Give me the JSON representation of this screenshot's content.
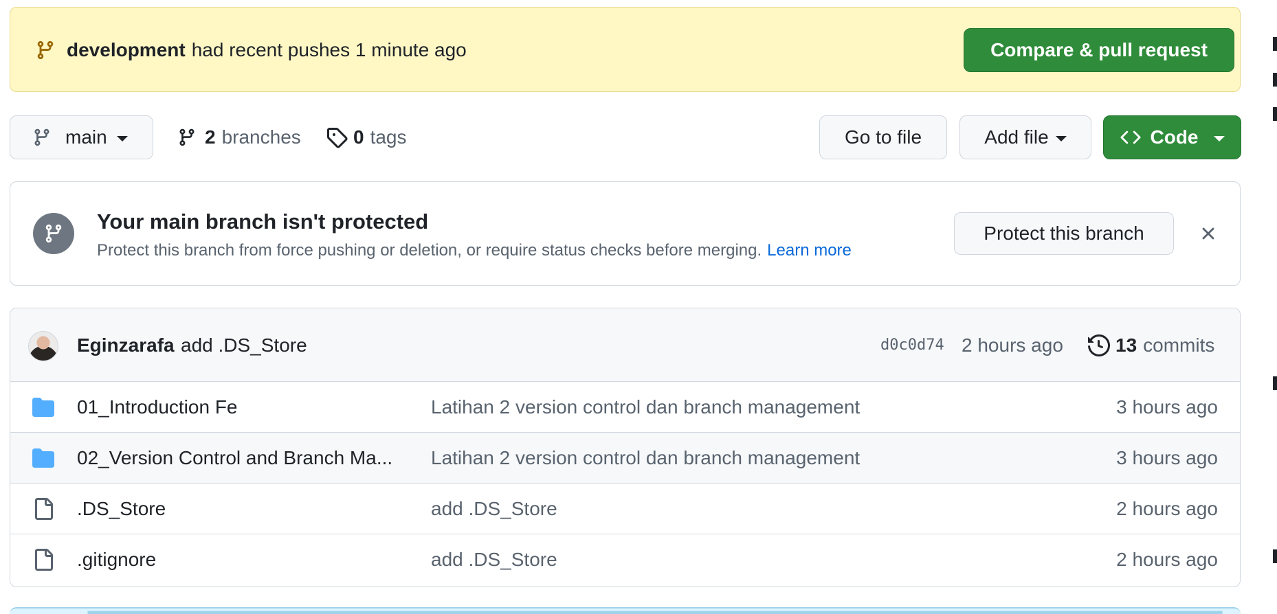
{
  "push_banner": {
    "branch": "development",
    "message": "had recent pushes 1 minute ago",
    "button": "Compare & pull request"
  },
  "toolbar": {
    "current_branch": "main",
    "branches_count": "2",
    "branches_label": "branches",
    "tags_count": "0",
    "tags_label": "tags",
    "go_to_file": "Go to file",
    "add_file": "Add file",
    "code": "Code"
  },
  "protection": {
    "title": "Your main branch isn't protected",
    "description": "Protect this branch from force pushing or deletion, or require status checks before merging.",
    "learn_more": "Learn more",
    "button": "Protect this branch"
  },
  "latest_commit": {
    "author": "Eginzarafa",
    "message": "add .DS_Store",
    "sha": "d0c0d74",
    "time": "2 hours ago",
    "commit_count": "13",
    "commit_label": "commits"
  },
  "files": [
    {
      "type": "folder",
      "name": "01_Introduction Fe",
      "commit": "Latihan 2 version control dan branch management",
      "age": "3 hours ago"
    },
    {
      "type": "folder",
      "name": "02_Version Control and Branch Ma...",
      "commit": "Latihan 2 version control dan branch management",
      "age": "3 hours ago"
    },
    {
      "type": "file",
      "name": ".DS_Store",
      "commit": "add .DS_Store",
      "age": "2 hours ago"
    },
    {
      "type": "file",
      "name": ".gitignore",
      "commit": "add .DS_Store",
      "age": "2 hours ago"
    }
  ],
  "icons": {
    "banner": "git-branch-icon",
    "branch_select": "git-branch-icon",
    "tags": "tag-icon",
    "code": "code-icon",
    "protection": "git-branch-icon",
    "close": "close-icon",
    "history": "history-icon",
    "folder": "folder-icon",
    "file": "file-icon"
  },
  "colors": {
    "banner_bg": "#fff8c5",
    "primary_green": "#2f8c3a",
    "link_blue": "#0969da",
    "folder_blue": "#54aeff",
    "muted_text": "#59636e"
  }
}
